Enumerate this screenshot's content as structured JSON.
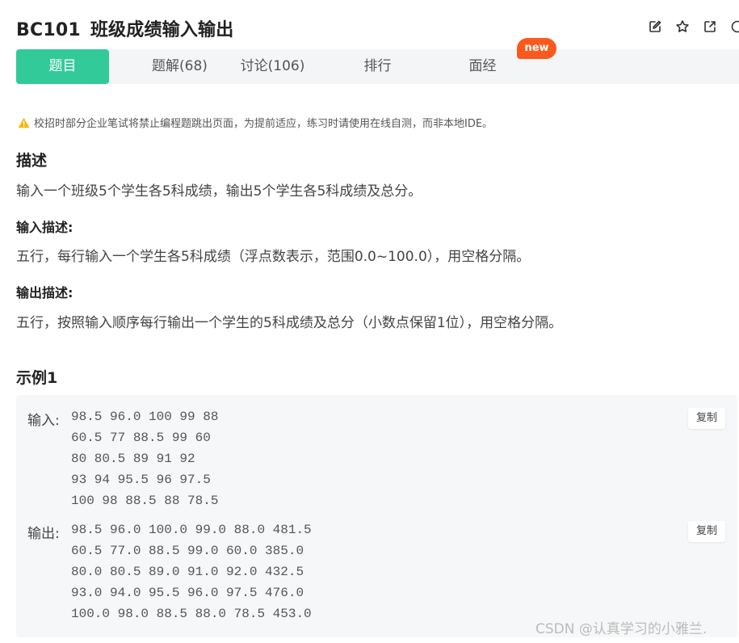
{
  "header": {
    "problem_code": "BC101",
    "problem_title": "班级成绩输入输出"
  },
  "tabs": [
    {
      "label": "题目",
      "active": true
    },
    {
      "label": "题解(68)"
    },
    {
      "label": "讨论(106)"
    },
    {
      "label": "排行"
    },
    {
      "label": "面经"
    }
  ],
  "new_badge": "new",
  "notice": "校招时部分企业笔试将禁止编程题跳出页面，为提前适应，练习时请使用在线自测，而非本地IDE。",
  "sections": {
    "description_title": "描述",
    "description": "输入一个班级5个学生各5科成绩，输出5个学生各5科成绩及总分。",
    "input_title": "输入描述:",
    "input_desc": "五行，每行输入一个学生各5科成绩（浮点数表示，范围0.0~100.0），用空格分隔。",
    "output_title": "输出描述:",
    "output_desc": "五行，按照输入顺序每行输出一个学生的5科成绩及总分（小数点保留1位），用空格分隔。"
  },
  "example": {
    "title": "示例1",
    "input_label": "输入:",
    "input_lines": [
      "98.5 96.0 100 99 88",
      "60.5 77 88.5 99 60",
      "80 80.5 89 91 92",
      "93 94 95.5 96 97.5",
      "100 98 88.5 88 78.5"
    ],
    "output_label": "输出:",
    "output_lines": [
      "98.5 96.0 100.0 99.0 88.0 481.5",
      "60.5 77.0 88.5 99.0 60.0 385.0",
      "80.0 80.5 89.0 91.0 92.0 432.5",
      "93.0 94.0 95.5 96.0 97.5 476.0",
      "100.0 98.0 88.5 88.0 78.5 453.0"
    ],
    "copy_label": "复制"
  },
  "watermark": "CSDN @认真学习的小雅兰.",
  "colors": {
    "accent": "#32ca99",
    "badge": "#fa5a1e",
    "warning": "#f5b90f"
  },
  "icons": [
    "edit-icon",
    "star-icon",
    "external-link-icon",
    "clock-icon",
    "warning-icon"
  ]
}
